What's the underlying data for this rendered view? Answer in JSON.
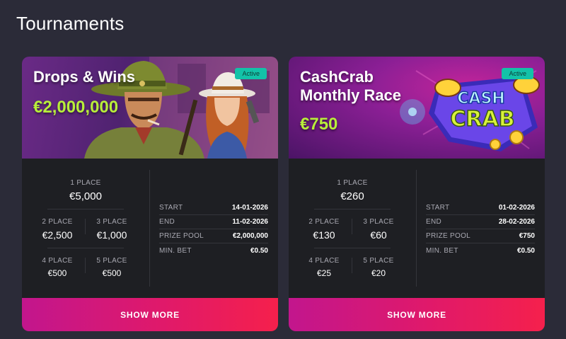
{
  "section_title": "Tournaments",
  "colors": {
    "background": "#2b2b38",
    "card": "#1e1f23",
    "prize_accent": "#b8ee3a",
    "active_badge": "#13c2a8",
    "button_start": "#c2168d",
    "button_end": "#f5204c"
  },
  "tournaments": [
    {
      "title": "Drops & Wins",
      "prize": "€2,000,000",
      "status": "Active",
      "banner_art": "cowboy-and-cowgirl-illustration",
      "places": [
        {
          "label": "1 PLACE",
          "value": "€5,000"
        },
        {
          "label": "2 PLACE",
          "value": "€2,500"
        },
        {
          "label": "3 PLACE",
          "value": "€1,000"
        },
        {
          "label": "4 PLACE",
          "value": "€500"
        },
        {
          "label": "5 PLACE",
          "value": "€500"
        }
      ],
      "info": [
        {
          "key": "START",
          "value": "14-01-2026"
        },
        {
          "key": "END",
          "value": "11-02-2026"
        },
        {
          "key": "PRIZE POOL",
          "value": "€2,000,000"
        },
        {
          "key": "MIN. BET",
          "value": "€0.50"
        }
      ],
      "button": "SHOW MORE"
    },
    {
      "title": "CashCrab Monthly Race",
      "prize": "€750",
      "status": "Active",
      "banner_art": "cash-crab-logo",
      "logo_text": [
        "CASH",
        "CRAB"
      ],
      "places": [
        {
          "label": "1 PLACE",
          "value": "€260"
        },
        {
          "label": "2 PLACE",
          "value": "€130"
        },
        {
          "label": "3 PLACE",
          "value": "€60"
        },
        {
          "label": "4 PLACE",
          "value": "€25"
        },
        {
          "label": "5 PLACE",
          "value": "€20"
        }
      ],
      "info": [
        {
          "key": "START",
          "value": "01-02-2026"
        },
        {
          "key": "END",
          "value": "28-02-2026"
        },
        {
          "key": "PRIZE POOL",
          "value": "€750"
        },
        {
          "key": "MIN. BET",
          "value": "€0.50"
        }
      ],
      "button": "SHOW MORE"
    }
  ]
}
